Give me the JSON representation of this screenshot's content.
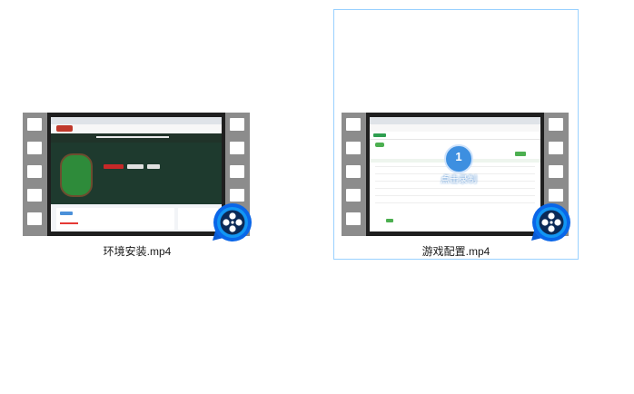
{
  "files": [
    {
      "name": "环境安装.mp4",
      "icon": "video-file-icon",
      "selected": false
    },
    {
      "name": "游戏配置.mp4",
      "icon": "video-file-icon",
      "selected": true
    }
  ],
  "thumbnail2_overlay": {
    "step_number": "1",
    "caption": "点击录制"
  }
}
